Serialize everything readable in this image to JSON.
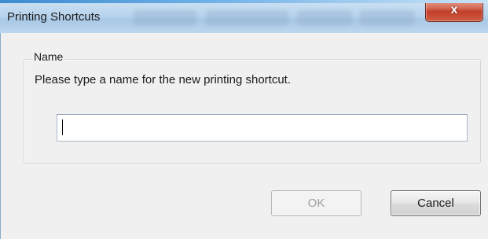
{
  "dialog": {
    "title": "Printing Shortcuts",
    "close_glyph": "x"
  },
  "group": {
    "legend": "Name",
    "prompt": "Please type a name for the new printing shortcut."
  },
  "name_input": {
    "value": "",
    "placeholder": ""
  },
  "buttons": {
    "ok_label": "OK",
    "ok_enabled": false,
    "cancel_label": "Cancel"
  },
  "icons": {
    "close": "close-icon"
  },
  "colors": {
    "title_bar": "#b6d2ec",
    "close_button": "#c2402a",
    "client_background": "#f0f0f0",
    "disabled_text": "#a0a0a0"
  }
}
